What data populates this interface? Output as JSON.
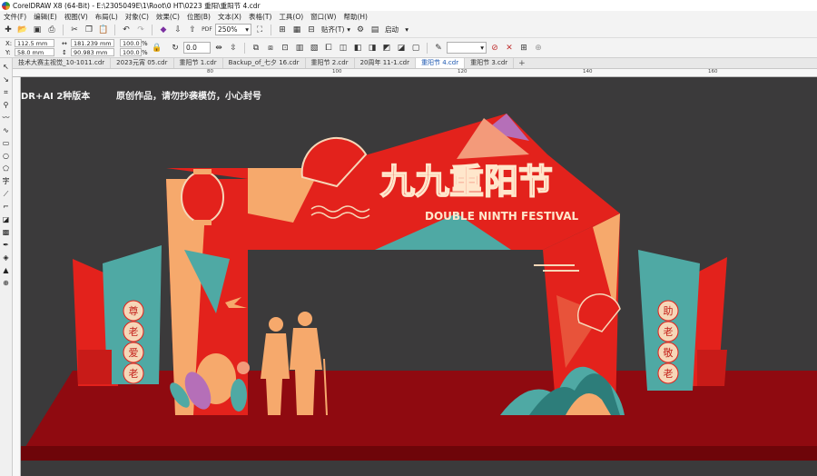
{
  "window": {
    "title": "CorelDRAW X8 (64-Bit) - E:\\2305049E\\1\\Root\\0 HT\\0223 重阳\\重阳节 4.cdr"
  },
  "menu": [
    "文件(F)",
    "编辑(E)",
    "视图(V)",
    "布局(L)",
    "对象(C)",
    "效果(C)",
    "位图(B)",
    "文本(X)",
    "表格(T)",
    "工具(O)",
    "窗口(W)",
    "帮助(H)"
  ],
  "toolbar": {
    "zoom": "250%",
    "snap_label": "贴齐(T)",
    "launch_label": "启动"
  },
  "props": {
    "x_label": "X:",
    "x": "112.5 mm",
    "y_label": "Y:",
    "y": "58.0 mm",
    "w": "181.239 mm",
    "h": "90.983 mm",
    "scale_x": "100.0",
    "scale_y": "100.0",
    "percent": "%",
    "angle": "0.0",
    "outline": ""
  },
  "tabs": [
    "技术大赛主视觉_10-1011.cdr",
    "2023元宵 05.cdr",
    "重阳节 1.cdr",
    "Backup_of_七夕 16.cdr",
    "重阳节 2.cdr",
    "20周年 11-1.cdr",
    "重阳节 4.cdr",
    "重阳节 3.cdr"
  ],
  "active_tab": 6,
  "ruler": [
    "80",
    "100",
    "120",
    "140",
    "160"
  ],
  "canvas": {
    "notice_a": "DR+AI 2种版本",
    "notice_b": "原创作品，请勿抄袭模仿，小心封号",
    "title_cn": "九九重阳节",
    "title_en": "DOUBLE NINTH FESTIVAL",
    "left_sign": [
      "尊",
      "老",
      "爱",
      "老"
    ],
    "right_sign": [
      "助",
      "老",
      "敬",
      "老"
    ]
  },
  "colors": {
    "red": "#e3221c",
    "darkred": "#8f0a10",
    "teal": "#4fa9a4",
    "peach": "#f6a96c",
    "canvas": "#3b3a3b"
  }
}
